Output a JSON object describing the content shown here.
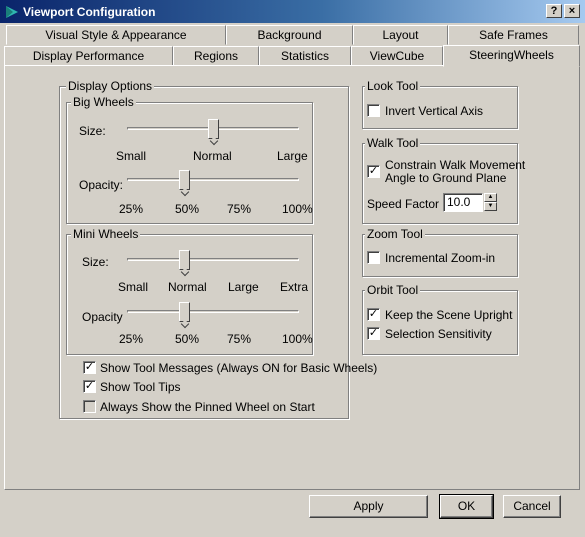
{
  "window": {
    "title": "Viewport Configuration",
    "help_btn": "?",
    "close_btn": "×"
  },
  "tabs_row1": [
    "Visual Style & Appearance",
    "Background",
    "Layout",
    "Safe Frames"
  ],
  "tabs_row2": [
    "Display Performance",
    "Regions",
    "Statistics",
    "ViewCube",
    "SteeringWheels"
  ],
  "active_tab": "SteeringWheels",
  "display_options": {
    "legend": "Display Options",
    "big_wheels": {
      "legend": "Big Wheels",
      "size_label": "Size:",
      "size_ticks": [
        "Small",
        "Normal",
        "Large"
      ],
      "size_value": 0.5,
      "opacity_label": "Opacity:",
      "opacity_ticks": [
        "25%",
        "50%",
        "75%",
        "100%"
      ],
      "opacity_value": 0.333
    },
    "mini_wheels": {
      "legend": "Mini Wheels",
      "size_label": "Size:",
      "size_ticks": [
        "Small",
        "Normal",
        "Large",
        "Extra"
      ],
      "size_value": 0.333,
      "opacity_label": "Opacity",
      "opacity_ticks": [
        "25%",
        "50%",
        "75%",
        "100%"
      ],
      "opacity_value": 0.333
    },
    "show_tool_messages": {
      "label": "Show Tool Messages (Always ON for Basic Wheels)",
      "checked": true
    },
    "show_tool_tips": {
      "label": "Show Tool Tips",
      "checked": true
    },
    "always_show_pinned": {
      "label": "Always Show the Pinned Wheel on Start",
      "checked": false
    }
  },
  "look_tool": {
    "legend": "Look Tool",
    "invert_vertical": {
      "label": "Invert Vertical Axis",
      "checked": false
    }
  },
  "walk_tool": {
    "legend": "Walk Tool",
    "constrain_line1": "Constrain Walk Movement",
    "constrain_line2": "Angle to Ground Plane",
    "constrain_checked": true,
    "speed_label": "Speed Factor",
    "speed_value": "10.0"
  },
  "zoom_tool": {
    "legend": "Zoom Tool",
    "incremental": {
      "label": "Incremental Zoom-in",
      "checked": false
    }
  },
  "orbit_tool": {
    "legend": "Orbit Tool",
    "keep_upright": {
      "label": "Keep the Scene Upright",
      "checked": true
    },
    "selection_sensitivity": {
      "label": "Selection Sensitivity",
      "checked": true
    }
  },
  "buttons": {
    "apply": "Apply",
    "ok": "OK",
    "cancel": "Cancel"
  },
  "colors": {
    "titlebar_start": "#0a246a",
    "titlebar_end": "#a6caf0",
    "face": "#d4d0c8"
  }
}
